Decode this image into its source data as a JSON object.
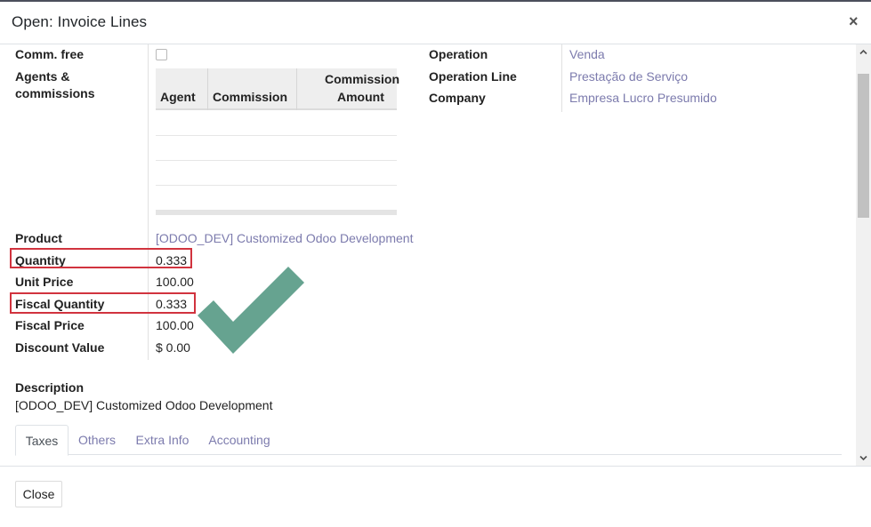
{
  "dialog": {
    "title": "Open: Invoice Lines",
    "close_symbol": "×"
  },
  "left_fields": {
    "comm_free_label": "Comm. free",
    "agents_label_line1": "Agents &",
    "agents_label_line2": "commissions",
    "product_label": "Product",
    "product_value": "[ODOO_DEV] Customized Odoo Development",
    "quantity_label": "Quantity",
    "quantity_value": "0.333",
    "unit_price_label": "Unit Price",
    "unit_price_value": "100.00",
    "fiscal_quantity_label": "Fiscal Quantity",
    "fiscal_quantity_value": "0.333",
    "fiscal_price_label": "Fiscal Price",
    "fiscal_price_value": "100.00",
    "discount_value_label": "Discount Value",
    "discount_value_value": "$ 0.00"
  },
  "agents_table": {
    "columns": [
      "Agent",
      "Commission",
      "Commission",
      "Amount"
    ]
  },
  "right_fields": {
    "operation_label": "Operation",
    "operation_value": "Venda",
    "operation_line_label": "Operation Line",
    "operation_line_value": "Prestação de Serviço",
    "company_label": "Company",
    "company_value": "Empresa Lucro Presumido"
  },
  "description": {
    "label": "Description",
    "value": "[ODOO_DEV] Customized Odoo Development"
  },
  "tabs": [
    {
      "label": "Taxes",
      "active": true
    },
    {
      "label": "Others",
      "active": false
    },
    {
      "label": "Extra Info",
      "active": false
    },
    {
      "label": "Accounting",
      "active": false
    }
  ],
  "footer": {
    "close_label": "Close"
  },
  "colors": {
    "link": "#7c7bad",
    "highlight": "#d1333e",
    "checkmark": "#5e9e8a"
  },
  "icons": {
    "close": "close-icon",
    "checkmark": "checkmark-icon",
    "scroll_up": "chevron-up-icon",
    "scroll_down": "chevron-down-icon"
  }
}
